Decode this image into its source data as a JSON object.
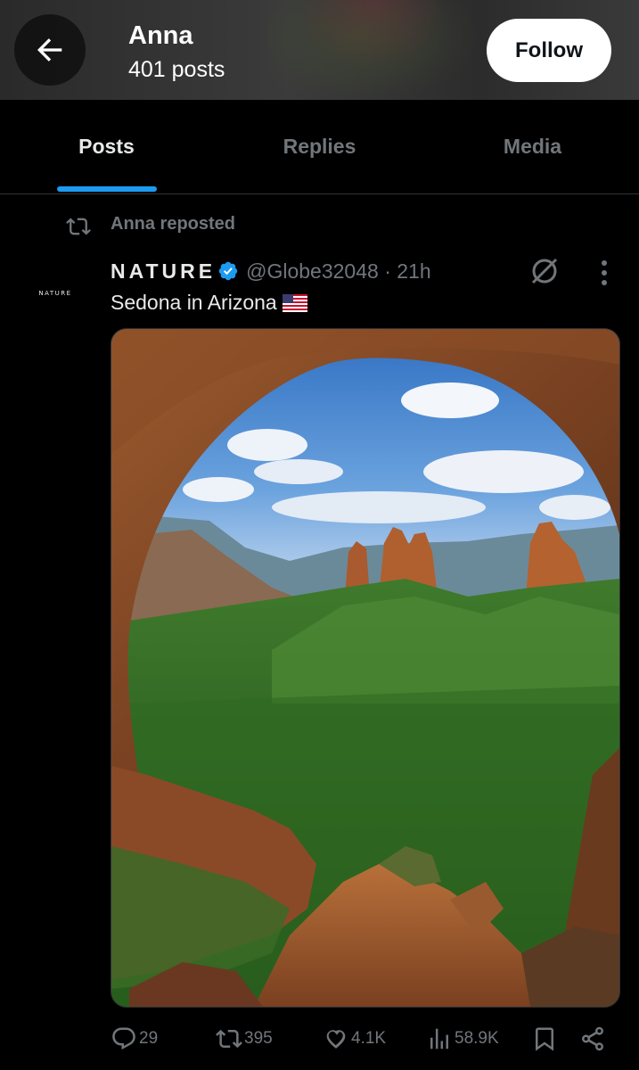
{
  "header": {
    "name": "Anna",
    "post_count": "401 posts",
    "follow_label": "Follow"
  },
  "tabs": [
    {
      "label": "Posts",
      "active": true
    },
    {
      "label": "Replies",
      "active": false
    },
    {
      "label": "Media",
      "active": false
    }
  ],
  "post": {
    "repost_label": "Anna reposted",
    "avatar_text": "NATURE",
    "author_name": "NATURE",
    "handle_time": "@Globe32048 · 21h",
    "text": "Sedona in Arizona",
    "flag_icon": "us-flag-icon",
    "actions": {
      "replies": "29",
      "reposts": "395",
      "likes": "4.1K",
      "views": "58.9K"
    }
  },
  "colors": {
    "accent": "#1d9bf0",
    "background": "#000000",
    "muted": "#71767b"
  }
}
